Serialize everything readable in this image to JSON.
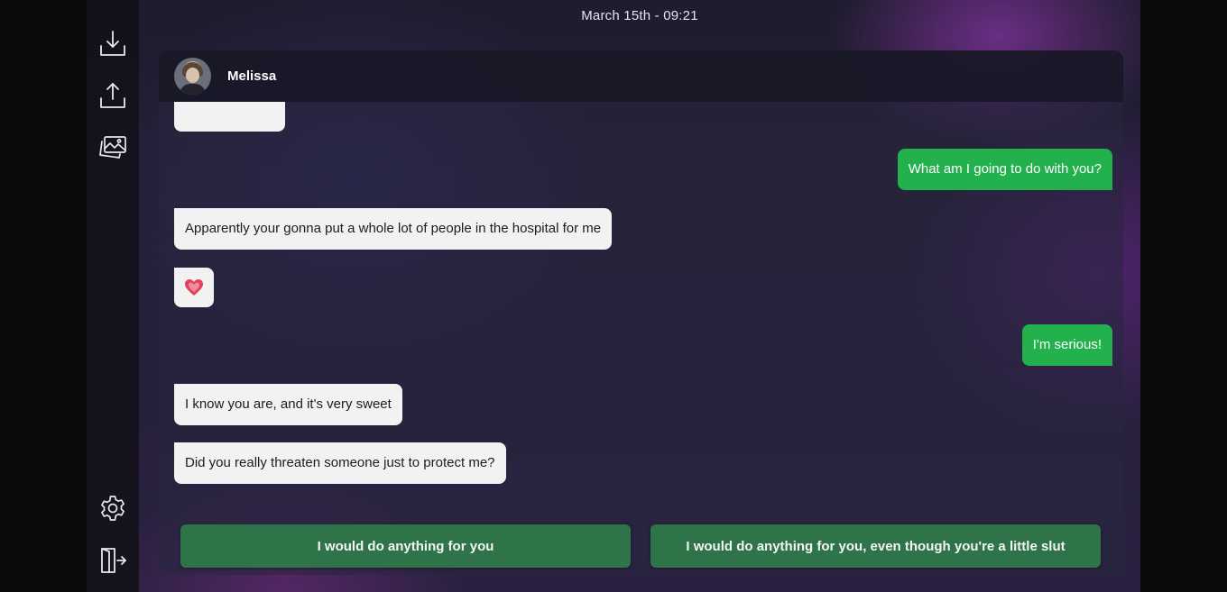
{
  "header": {
    "datetime": "March 15th - 09:21"
  },
  "sidebar": {
    "top_icons": [
      "download-icon",
      "upload-icon",
      "gallery-icon"
    ],
    "bottom_icons": [
      "settings-icon",
      "exit-icon"
    ]
  },
  "chat": {
    "contact_name": "Melissa",
    "messages": [
      {
        "from": "them",
        "text": ""
      },
      {
        "from": "me",
        "text": "What am I going to do with you?"
      },
      {
        "from": "them",
        "text": "Apparently your gonna put a whole lot of people in the hospital for me"
      },
      {
        "from": "them",
        "text": "",
        "emoji": "heart"
      },
      {
        "from": "me",
        "text": "I'm serious!"
      },
      {
        "from": "them",
        "text": "I know you are, and it's very sweet"
      },
      {
        "from": "them",
        "text": "Did you really threaten someone just to protect me?"
      }
    ]
  },
  "choices": [
    {
      "label": "I would do anything for you"
    },
    {
      "label": "I would do anything for you, even though you're a little slut"
    }
  ],
  "colors": {
    "outgoing_bubble": "#22b14c",
    "incoming_bubble": "#f2f2f2",
    "choice_button": "#2f7449",
    "heart": "#e0435b"
  }
}
